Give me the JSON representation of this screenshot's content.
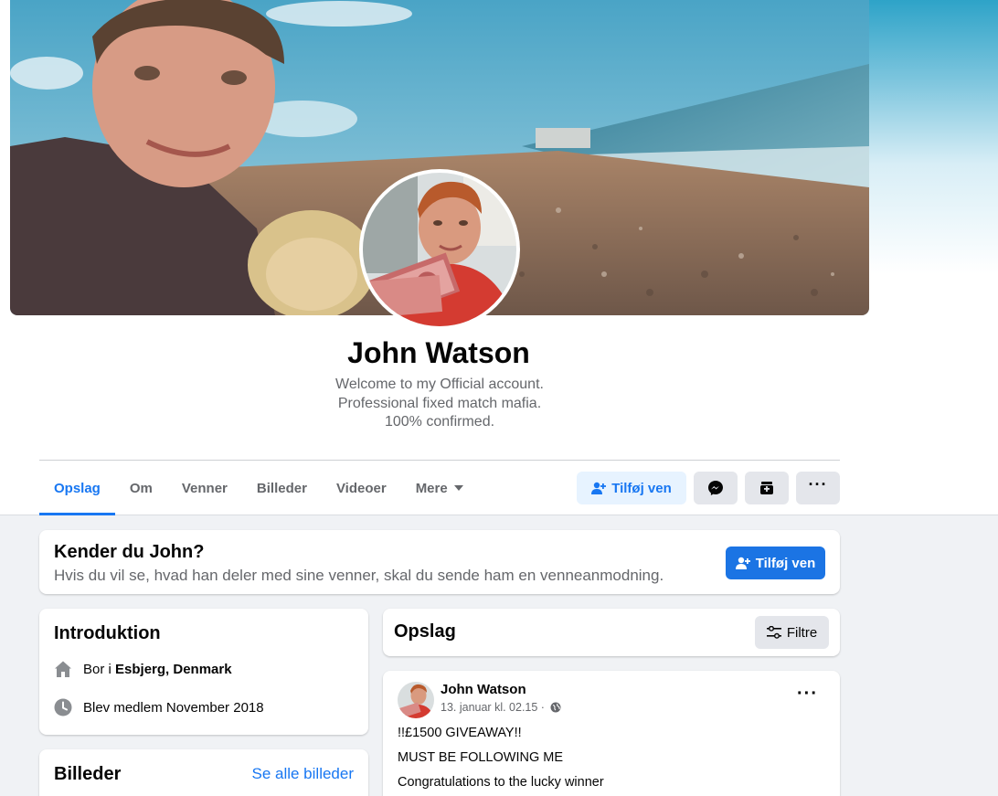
{
  "profile": {
    "name": "John Watson",
    "bio_lines": [
      "Welcome to my Official account.",
      "Professional fixed match mafia.",
      "100% confirmed."
    ]
  },
  "tabs": [
    {
      "label": "Opslag",
      "active": true
    },
    {
      "label": "Om"
    },
    {
      "label": "Venner"
    },
    {
      "label": "Billeder"
    },
    {
      "label": "Videoer"
    },
    {
      "label": "Mere"
    }
  ],
  "actions": {
    "add_friend": "Tilføj ven",
    "messenger_icon": "messenger-icon",
    "follow_icon": "save-box-icon",
    "more_icon": "more-dots-icon"
  },
  "know": {
    "title": "Kender du John?",
    "subtitle": "Hvis du vil se, hvad han deler med sine venner, skal du sende ham en venneanmodning.",
    "button": "Tilføj ven"
  },
  "intro": {
    "title": "Introduktion",
    "lives_prefix": "Bor i ",
    "lives_place": "Esbjerg, Denmark",
    "member": "Blev medlem November 2018"
  },
  "photos": {
    "title": "Billeder",
    "see_all": "Se alle billeder"
  },
  "posts_header": {
    "title": "Opslag",
    "filter": "Filtre"
  },
  "post": {
    "author": "John Watson",
    "time": "13. januar kl. 02.15 · ",
    "privacy_icon": "globe-icon",
    "lines": [
      "!!£1500 GIVEAWAY!!",
      "MUST BE FOLLOWING ME",
      "Congratulations to the lucky winner"
    ]
  },
  "colors": {
    "accent": "#1877f2",
    "background": "#f0f2f5",
    "secondary_text": "#65676b"
  }
}
